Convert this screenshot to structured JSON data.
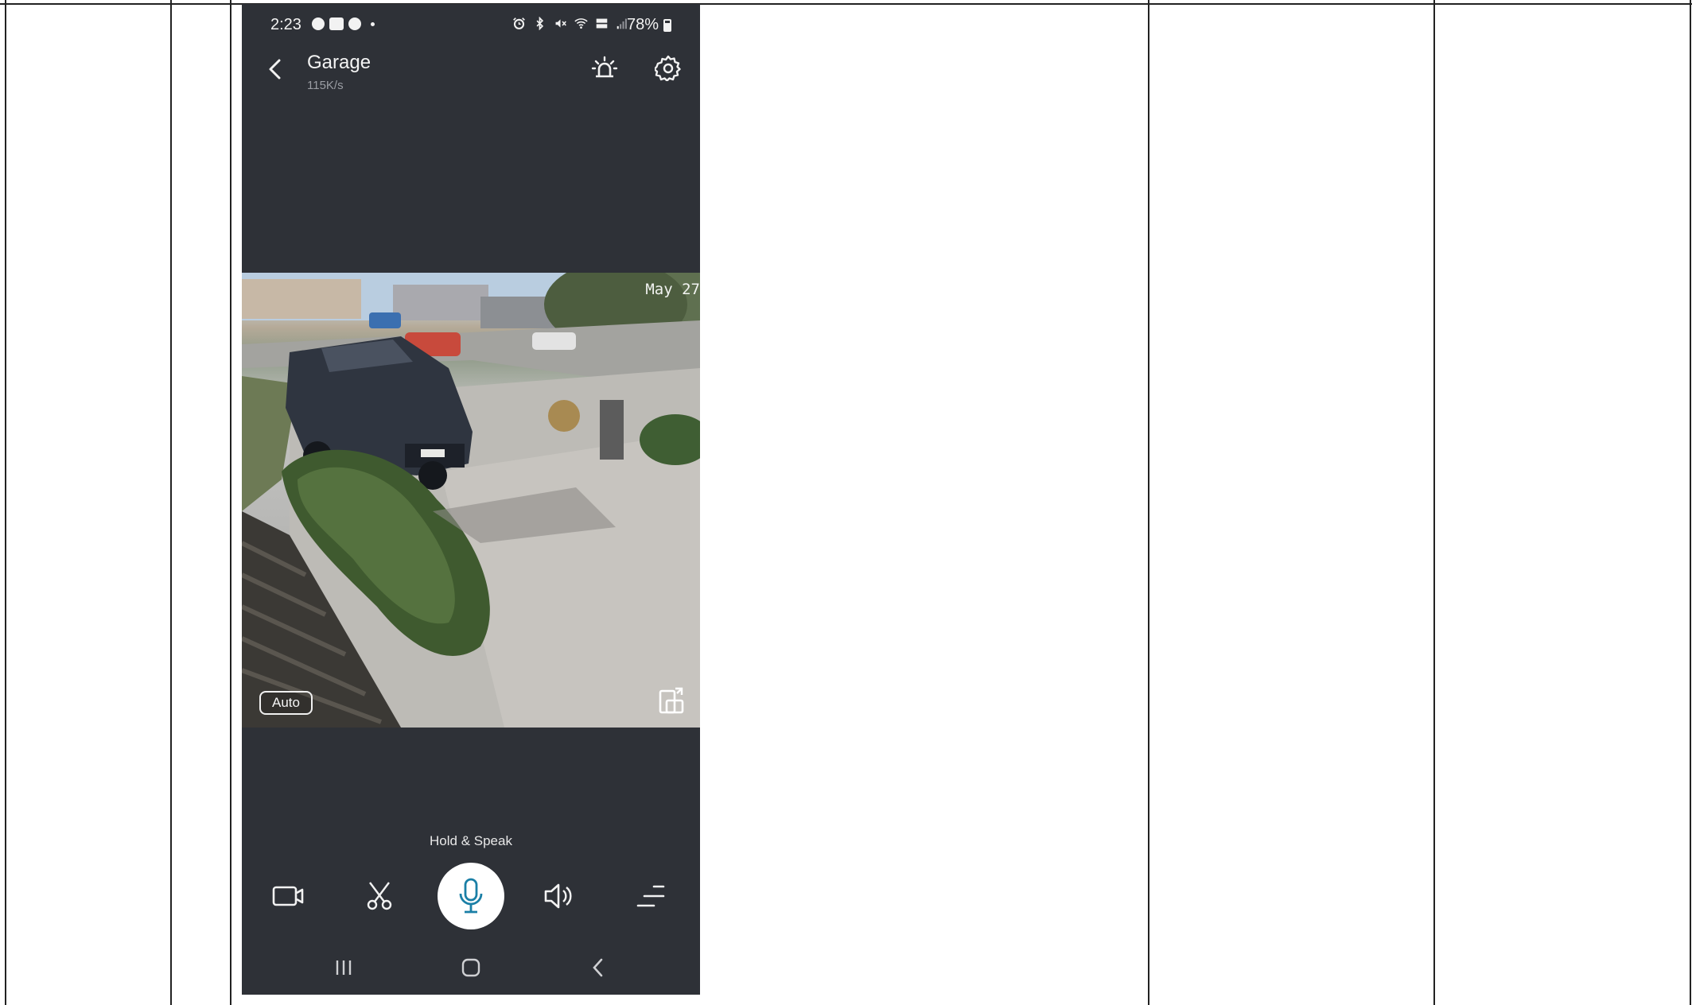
{
  "status_bar": {
    "time": "2:23",
    "battery": "78%",
    "left_icons": [
      "snapchat-icon",
      "gallery-icon",
      "messenger-icon"
    ],
    "right_icons": [
      "alarm-icon",
      "bluetooth-icon",
      "mute-icon",
      "wifi-icon",
      "volte-icon",
      "signal-icon"
    ]
  },
  "app_bar": {
    "title": "Garage",
    "subtitle": "115K/s",
    "back_icon": "chevron-left-icon",
    "alarm_icon": "siren-icon",
    "settings_icon": "gear-icon"
  },
  "video": {
    "timestamp": "May 27",
    "quality_label": "Auto",
    "rotate_icon": "rotate-screen-icon"
  },
  "talk": {
    "hint": "Hold & Speak"
  },
  "controls": [
    "video-record-icon",
    "scissors-icon",
    "microphone-icon",
    "speaker-icon",
    "menu-icon"
  ],
  "nav_bar": [
    "recent-apps-icon",
    "home-icon",
    "back-icon"
  ],
  "colors": {
    "panel_background": "#2e3137",
    "mic_accent": "#1a7fa6",
    "text_primary": "#f4f4f4",
    "text_secondary": "#9a9da3"
  }
}
